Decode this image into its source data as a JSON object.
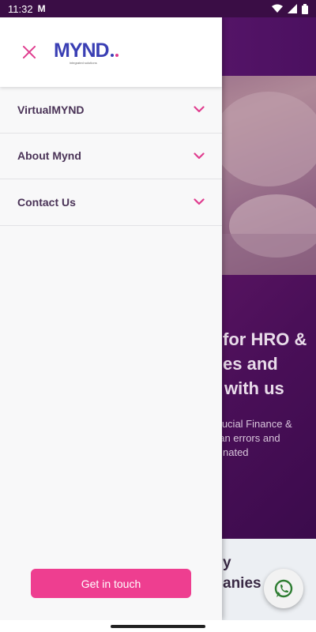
{
  "status_bar": {
    "time": "11:32",
    "notification": "M"
  },
  "drawer": {
    "logo_text": "MYND",
    "logo_tagline": "integrated solutions",
    "menu": [
      {
        "label": "VirtualMYND"
      },
      {
        "label": "About Mynd"
      },
      {
        "label": "Contact Us"
      }
    ],
    "cta_label": "Get in touch"
  },
  "background": {
    "hero_line1": "for HRO &",
    "hero_line2": "es and",
    "hero_line3": "with us",
    "sub_line1": "crucial Finance &",
    "sub_line2": "nan errors and",
    "sub_line3": "nated",
    "card_line1": "y",
    "card_line2": "anies"
  },
  "colors": {
    "accent": "#ee3e90",
    "brand_blue": "#3a3fb4",
    "menu_text": "#4a3357",
    "hero_bg": "#4a0f58"
  }
}
